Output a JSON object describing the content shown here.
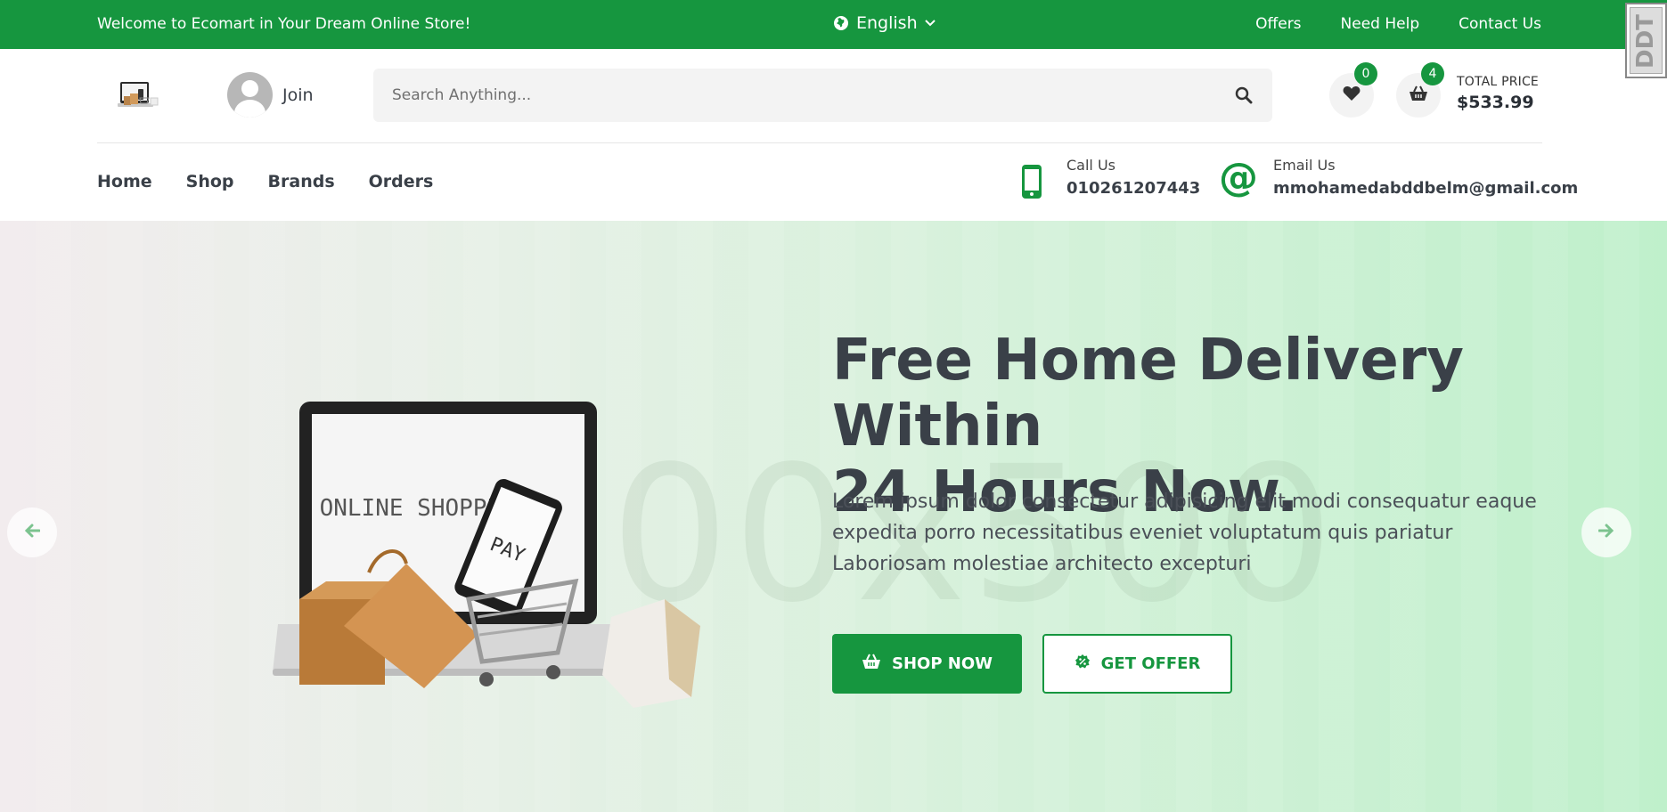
{
  "topbar": {
    "welcome": "Welcome to Ecomart in Your Dream Online Store!",
    "language": "English",
    "links": [
      "Offers",
      "Need Help",
      "Contact Us"
    ]
  },
  "watermark": "DDT",
  "header": {
    "join_label": "Join",
    "search_placeholder": "Search Anything...",
    "wishlist_count": "0",
    "cart_count": "4",
    "total_label": "TOTAL PRICE",
    "total_value": "$533.99"
  },
  "nav": {
    "items": [
      "Home",
      "Shop",
      "Brands",
      "Orders"
    ]
  },
  "contact": {
    "call_label": "Call Us",
    "call_value": "010261207443",
    "email_label": "Email Us",
    "email_value": "mmohamedabddbelm@gmail.com"
  },
  "hero": {
    "title_line1": "Free Home Delivery Within",
    "title_line2": "24 Hours Now.",
    "description": "Lorem ipsum dolor consectetur adipisicing elit modi consequatur eaque expedita porro necessitatibus eveniet voluptatum quis pariatur Laboriosam molestiae architecto excepturi",
    "placeholder_text": "00x500",
    "illustration_screen_text": "ONLINE SHOPPING",
    "illustration_phone_text": "PAY",
    "shop_now_label": "SHOP NOW",
    "get_offer_label": "GET OFFER"
  },
  "colors": {
    "brand_green": "#16963f",
    "text_dark": "#3a4048"
  },
  "icons": [
    "globe-icon",
    "chevron-down-icon",
    "user-avatar-icon",
    "search-icon",
    "heart-icon",
    "basket-icon",
    "phone-icon",
    "at-icon",
    "badge-icon",
    "arrow-left-icon",
    "arrow-right-icon"
  ]
}
